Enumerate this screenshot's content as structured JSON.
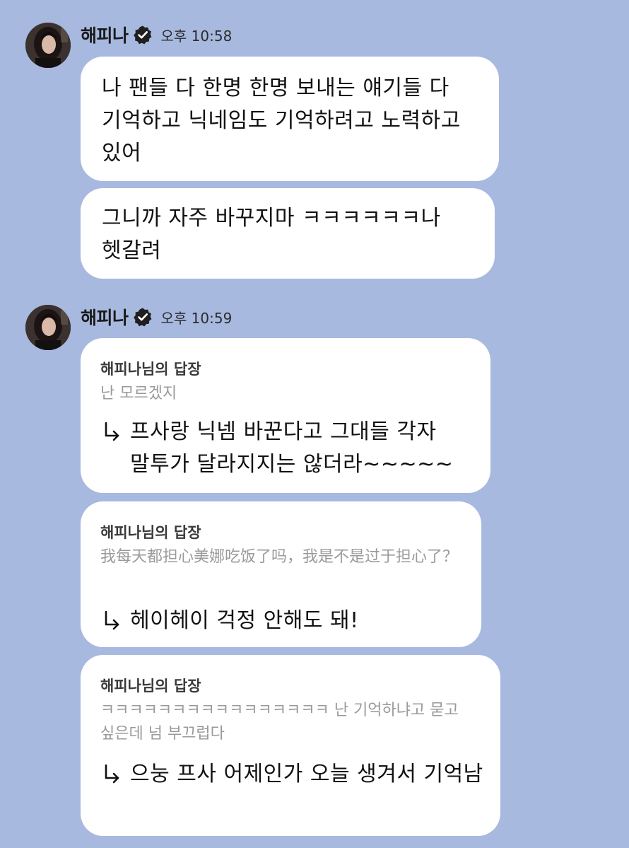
{
  "colors": {
    "background": "#a8b9e0",
    "bubble": "#ffffff",
    "quote_text": "#9a9a9a",
    "verified_badge": "#1f1f1f"
  },
  "groups": [
    {
      "sender": "해피나",
      "time": "오후 10:58",
      "messages": [
        {
          "text": "나 팬들 다 한명 한명 보내는 얘기들 다 기억하고 닉네임도 기억하려고 노력하고 있어"
        },
        {
          "text": "그니까 자주 바꾸지마 ㅋㅋㅋㅋㅋㅋ나 헷갈려"
        }
      ]
    },
    {
      "sender": "해피나",
      "time": "오후 10:59",
      "replies": [
        {
          "label": "해피나님의 답장",
          "quote": "난 모르겠지",
          "answer": "프사랑 닉넴 바꾼다고 그대들 각자 말투가 달라지지는 않더라~~~~~"
        },
        {
          "label": "해피나님의 답장",
          "quote": "我每天都担心美娜吃饭了吗，我是不是过于担心了？",
          "answer": "헤이헤이 걱정 안해도 돼!"
        },
        {
          "label": "해피나님의 답장",
          "quote": "ㅋㅋㅋㅋㅋㅋㅋㅋㅋㅋㅋㅋㅋㅋㅋㅋ 난 기억하냐고 묻고 싶은데 넘 부끄럽다",
          "answer": "으눙 프사 어제인가 오늘 생겨서 기억남"
        }
      ]
    }
  ]
}
